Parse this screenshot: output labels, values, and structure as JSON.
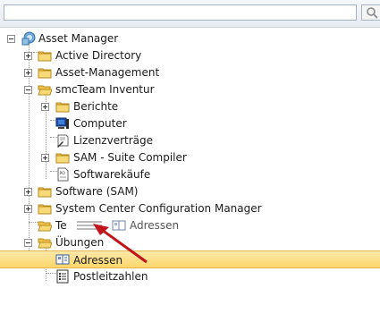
{
  "search": {
    "value": "",
    "placeholder": ""
  },
  "tree": {
    "items": [
      {
        "label": "Asset Manager"
      },
      {
        "label": "Active Directory"
      },
      {
        "label": "Asset-Management"
      },
      {
        "label": "smcTeam Inventur"
      },
      {
        "label": "Berichte"
      },
      {
        "label": "Computer"
      },
      {
        "label": "Lizenzverträge"
      },
      {
        "label": "SAM - Suite Compiler"
      },
      {
        "label": "Softwarekäufe"
      },
      {
        "label": "Software (SAM)"
      },
      {
        "label": "System Center Configuration Manager"
      },
      {
        "label": "Te"
      },
      {
        "label": "Übungen"
      },
      {
        "label": "Adressen"
      },
      {
        "label": "Postleitzahlen"
      }
    ]
  },
  "drag": {
    "label": "Adressen"
  },
  "colors": {
    "selection": "#fbd66c",
    "arrow": "#c0161b",
    "folder": "#f0c14b"
  }
}
